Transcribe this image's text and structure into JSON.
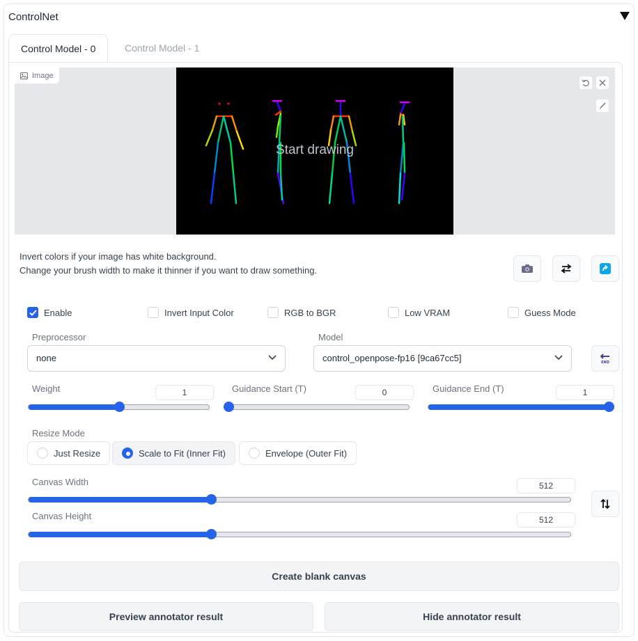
{
  "panel": {
    "title": "ControlNet"
  },
  "tabs": [
    {
      "label": "Control Model - 0",
      "active": true
    },
    {
      "label": "Control Model - 1",
      "active": false
    }
  ],
  "image": {
    "label": "Image",
    "overlay_text": "Start drawing"
  },
  "hints": [
    "Invert colors if your image has white background.",
    "Change your brush width to make it thinner if you want to draw something."
  ],
  "tool_buttons": [
    {
      "icon": "camera-icon"
    },
    {
      "icon": "swap-icon"
    },
    {
      "icon": "send-icon"
    }
  ],
  "checkboxes": [
    {
      "label": "Enable",
      "checked": true
    },
    {
      "label": "Invert Input Color",
      "checked": false
    },
    {
      "label": "RGB to BGR",
      "checked": false
    },
    {
      "label": "Low VRAM",
      "checked": false
    },
    {
      "label": "Guess Mode",
      "checked": false
    }
  ],
  "preprocessor": {
    "label": "Preprocessor",
    "value": "none"
  },
  "model": {
    "label": "Model",
    "value": "control_openpose-fp16 [9ca67cc5]"
  },
  "sliders": {
    "weight": {
      "label": "Weight",
      "value": "1",
      "fraction": 0.5
    },
    "guidance_start": {
      "label": "Guidance Start (T)",
      "value": "0",
      "fraction": 0.0
    },
    "guidance_end": {
      "label": "Guidance End (T)",
      "value": "1",
      "fraction": 1.0
    },
    "canvas_width": {
      "label": "Canvas Width",
      "value": "512",
      "fraction": 0.337
    },
    "canvas_height": {
      "label": "Canvas Height",
      "value": "512",
      "fraction": 0.337
    }
  },
  "resize_mode": {
    "label": "Resize Mode",
    "options": [
      {
        "label": "Just Resize",
        "selected": false
      },
      {
        "label": "Scale to Fit (Inner Fit)",
        "selected": true
      },
      {
        "label": "Envelope (Outer Fit)",
        "selected": false
      }
    ]
  },
  "buttons": {
    "create_blank": "Create blank canvas",
    "preview": "Preview annotator result",
    "hide": "Hide annotator result"
  },
  "colors": {
    "accent": "#2563eb"
  }
}
